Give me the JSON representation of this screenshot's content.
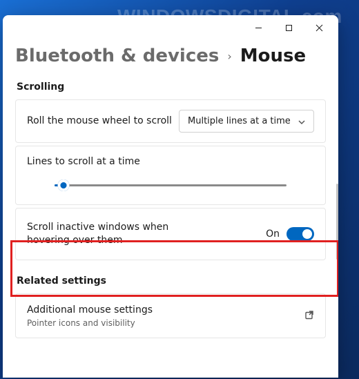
{
  "watermark": "WINDOWSDIGITAL.com",
  "breadcrumb": {
    "parent": "Bluetooth & devices",
    "separator": "›",
    "current": "Mouse"
  },
  "sections": {
    "scrolling_header": "Scrolling",
    "related_header": "Related settings"
  },
  "rows": {
    "scroll_mode": {
      "label": "Roll the mouse wheel to scroll",
      "value": "Multiple lines at a time"
    },
    "lines": {
      "label": "Lines to scroll at a time"
    },
    "inactive": {
      "label": "Scroll inactive windows when hovering over them",
      "state": "On"
    },
    "additional": {
      "label": "Additional mouse settings",
      "sub": "Pointer icons and visibility"
    }
  }
}
